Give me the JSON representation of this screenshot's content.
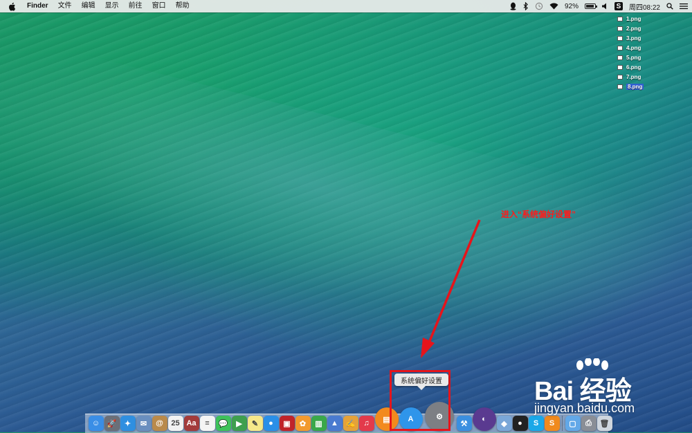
{
  "menubar": {
    "app_name": "Finder",
    "menus": [
      "文件",
      "编辑",
      "显示",
      "前往",
      "窗口",
      "帮助"
    ],
    "battery_percent": "92%",
    "battery_level": 0.92,
    "clock": "周四08:22",
    "status_icons": [
      "qq-icon",
      "bluetooth-icon",
      "time-machine-icon",
      "wifi-icon",
      "battery-icon",
      "volume-icon",
      "sogou-icon",
      "spotlight-icon",
      "notification-center-icon"
    ]
  },
  "desktop": {
    "files": [
      "1.png",
      "2.png",
      "3.png",
      "4.png",
      "5.png",
      "6.png",
      "7.png",
      "8.png"
    ],
    "selected_file": "8.png"
  },
  "annotation": {
    "text": "进入“系统偏好设置”",
    "color": "#ff1a1a"
  },
  "dock": {
    "tooltip": "系统偏好设置",
    "items": [
      {
        "name": "finder",
        "glyph": "☺",
        "color": "#3a8ee6"
      },
      {
        "name": "launchpad",
        "glyph": "🚀",
        "color": "#6b6f78"
      },
      {
        "name": "safari",
        "glyph": "✦",
        "color": "#2f8fe0"
      },
      {
        "name": "mail",
        "glyph": "✉",
        "color": "#6a8fbf"
      },
      {
        "name": "contacts",
        "glyph": "@",
        "color": "#b98a4b"
      },
      {
        "name": "calendar",
        "glyph": "25",
        "color": "#f2f2f2"
      },
      {
        "name": "dictionary",
        "glyph": "Aa",
        "color": "#a33b3b"
      },
      {
        "name": "reminders",
        "glyph": "≡",
        "color": "#f4f4f4"
      },
      {
        "name": "messages",
        "glyph": "💬",
        "color": "#3ec25a"
      },
      {
        "name": "facetime",
        "glyph": "▶",
        "color": "#3f9f4e"
      },
      {
        "name": "notes",
        "glyph": "✎",
        "color": "#f6e88a"
      },
      {
        "name": "qq-chat",
        "glyph": "●",
        "color": "#2a8fe8"
      },
      {
        "name": "photo-booth",
        "glyph": "▣",
        "color": "#c0242a"
      },
      {
        "name": "photos",
        "glyph": "✿",
        "color": "#f29a2e"
      },
      {
        "name": "numbers",
        "glyph": "▥",
        "color": "#3aa84a"
      },
      {
        "name": "keynote",
        "glyph": "▲",
        "color": "#4a7bd0"
      },
      {
        "name": "pages",
        "glyph": "✍",
        "color": "#e4a23a"
      },
      {
        "name": "itunes",
        "glyph": "♫",
        "color": "#e33a4b"
      },
      {
        "name": "ibooks",
        "glyph": "▤",
        "color": "#f28a1e"
      },
      {
        "name": "app-store",
        "glyph": "A",
        "color": "#2f95ea"
      },
      {
        "name": "system-preferences",
        "glyph": "⚙",
        "color": "#7d7f84"
      },
      {
        "name": "xcode",
        "glyph": "⚒",
        "color": "#3b8fe0"
      },
      {
        "name": "eclipse",
        "glyph": "◐",
        "color": "#5a3a90"
      },
      {
        "name": "virtualbox",
        "glyph": "◆",
        "color": "#7aa7d8"
      },
      {
        "name": "qq",
        "glyph": "●",
        "color": "#222222"
      },
      {
        "name": "skype",
        "glyph": "S",
        "color": "#1aa8e8"
      },
      {
        "name": "sogou",
        "glyph": "S",
        "color": "#f08a1e"
      },
      {
        "name": "applications-folder",
        "glyph": "▢",
        "color": "#62a8e8"
      },
      {
        "name": "printer",
        "glyph": "⎙",
        "color": "#8a8e96"
      },
      {
        "name": "trash",
        "glyph": "🗑",
        "color": "#cfd6de"
      }
    ]
  },
  "watermark": {
    "brand": "Bai 经验",
    "url": "jingyan.baidu.com"
  }
}
